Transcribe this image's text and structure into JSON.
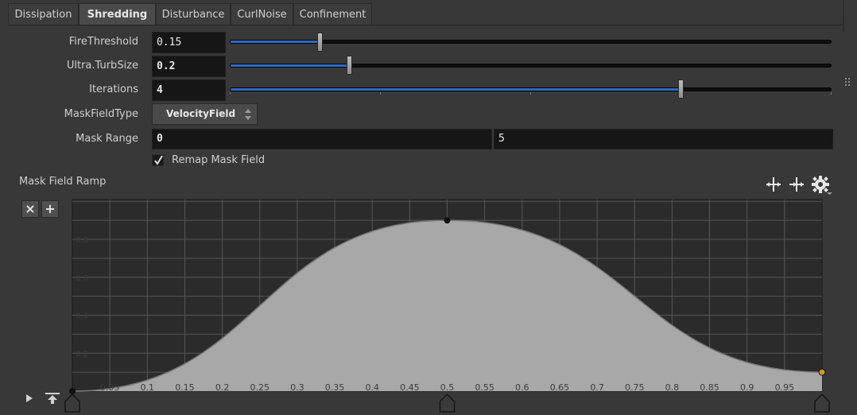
{
  "tabs": [
    {
      "label": "Dissipation",
      "active": false
    },
    {
      "label": "Shredding",
      "active": true
    },
    {
      "label": "Disturbance",
      "active": false
    },
    {
      "label": "CurlNoise",
      "active": false
    },
    {
      "label": "Confinement",
      "active": false
    }
  ],
  "params": {
    "fire_threshold": {
      "label": "FireThreshold",
      "value": "0.15",
      "level": 0.15
    },
    "ultra_turb_size": {
      "label": "Ultra.TurbSize",
      "value": "0.2",
      "level": 0.2
    },
    "iterations": {
      "label": "Iterations",
      "value": "4",
      "level": 0.75
    },
    "mask_field_type": {
      "label": "MaskFieldType",
      "value": "VelocityField"
    },
    "mask_range": {
      "label": "Mask Range",
      "min": "0",
      "max": "5"
    },
    "remap_mask_field": {
      "label": "Remap Mask Field",
      "checked": true
    }
  },
  "ramp": {
    "label": "Mask Field Ramp",
    "y_ticks": [
      "0.2",
      "0.4",
      "0.6",
      "0.8"
    ],
    "x_ticks": [
      "0.05",
      "0.1",
      "0.15",
      "0.2",
      "0.25",
      "0.3",
      "0.35",
      "0.4",
      "0.45",
      "0.5",
      "0.55",
      "0.6",
      "0.65",
      "0.7",
      "0.75",
      "0.8",
      "0.85",
      "0.9",
      "0.95"
    ],
    "keys": [
      {
        "pos": 0.0,
        "value": 0.0
      },
      {
        "pos": 0.5,
        "value": 0.9
      },
      {
        "pos": 1.0,
        "value": 0.1
      }
    ],
    "selected_key_color": "#c8962a",
    "fill_color": "#a8a8a8"
  },
  "colors": {
    "slider_fill": "#2e6bcc",
    "background": "#383838",
    "graph_background": "#2b2b2b"
  }
}
